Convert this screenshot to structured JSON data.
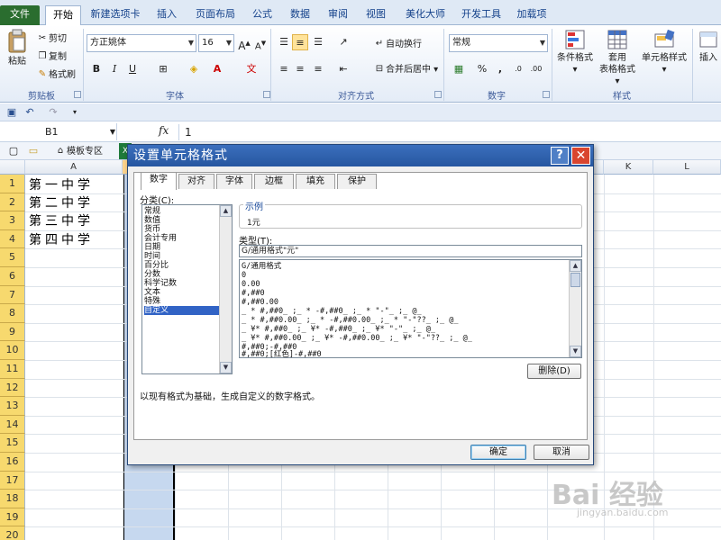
{
  "ribbon": {
    "tabs": [
      "文件",
      "开始",
      "新建选项卡",
      "插入",
      "页面布局",
      "公式",
      "数据",
      "审阅",
      "视图",
      "美化大师",
      "开发工具",
      "加载项"
    ],
    "clipboard": {
      "paste": "粘贴",
      "cut": "剪切",
      "copy": "复制",
      "format_painter": "格式刷",
      "label": "剪贴板"
    },
    "font": {
      "name": "方正姚体",
      "size": "16",
      "label": "字体",
      "bold": "B",
      "italic": "I",
      "underline": "U"
    },
    "alignment": {
      "wrap": "自动换行",
      "merge": "合并后居中",
      "label": "对齐方式"
    },
    "number": {
      "format": "常规",
      "percent": "%",
      "comma": ",",
      "label": "数字"
    },
    "styles": {
      "conditional": "条件格式",
      "table1": "套用",
      "table2": "表格格式",
      "cell_styles": "单元格样式",
      "label": "样式"
    },
    "cells": {
      "insert": "插入"
    }
  },
  "formula_bar": {
    "name_box": "B1",
    "fx": "fx",
    "value": "1"
  },
  "workbook_tabs": {
    "template": "模板专区"
  },
  "grid": {
    "columns": [
      "A",
      "K",
      "L"
    ],
    "rows": [
      "1",
      "2",
      "3",
      "4",
      "5",
      "6",
      "7",
      "8",
      "9",
      "10",
      "11",
      "12",
      "13",
      "14",
      "15",
      "16",
      "17",
      "18",
      "19",
      "20"
    ],
    "cells_A": [
      "第一中学",
      "第二中学",
      "第三中学",
      "第四中学"
    ]
  },
  "dialog": {
    "title": "设置单元格格式",
    "help": "?",
    "close": "✕",
    "tabs": [
      "数字",
      "对齐",
      "字体",
      "边框",
      "填充",
      "保护"
    ],
    "category_label": "分类(C):",
    "categories": [
      "常规",
      "数值",
      "货币",
      "会计专用",
      "日期",
      "时间",
      "百分比",
      "分数",
      "科学记数",
      "文本",
      "特殊",
      "自定义"
    ],
    "sample_label": "示例",
    "sample_value": "1元",
    "type_label": "类型(T):",
    "type_value": "G/通用格式\"元\"",
    "formats": [
      "G/通用格式",
      "0",
      "0.00",
      "#,##0",
      "#,##0.00",
      "_ * #,##0_ ;_ * -#,##0_ ;_ * \"-\"_ ;_ @_",
      "_ * #,##0.00_ ;_ * -#,##0.00_ ;_ * \"-\"??_ ;_ @_",
      "_ ¥* #,##0_ ;_ ¥* -#,##0_ ;_ ¥* \"-\"_ ;_ @_",
      "_ ¥* #,##0.00_ ;_ ¥* -#,##0.00_ ;_ ¥* \"-\"??_ ;_ @_",
      "#,##0;-#,##0",
      "#,##0;[红色]-#,##0"
    ],
    "delete_button": "删除(D)",
    "description": "以现有格式为基础，生成自定义的数字格式。",
    "ok_button": "确定",
    "cancel_button": "取消"
  },
  "watermark": {
    "main": "Bai 经验",
    "sub": "jingyan.baidu.com"
  }
}
